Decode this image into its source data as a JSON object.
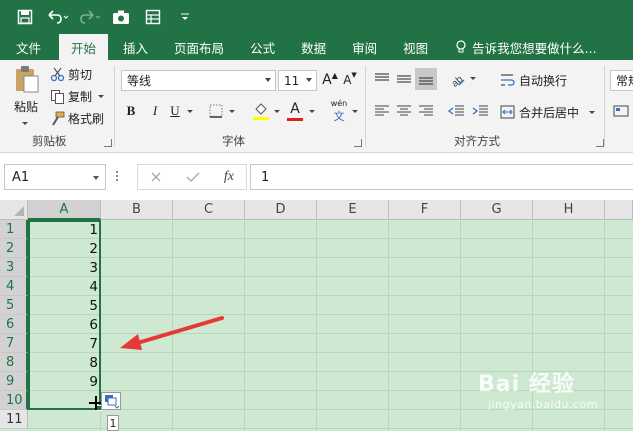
{
  "qat": {
    "icons": [
      "save-icon",
      "undo-icon",
      "redo-icon",
      "camera-icon",
      "form-icon",
      "customize-icon"
    ]
  },
  "tabs": [
    {
      "label": "文件"
    },
    {
      "label": "开始"
    },
    {
      "label": "插入"
    },
    {
      "label": "页面布局"
    },
    {
      "label": "公式"
    },
    {
      "label": "数据"
    },
    {
      "label": "审阅"
    },
    {
      "label": "视图"
    }
  ],
  "tell_me": "告诉我您想要做什么...",
  "clipboard": {
    "paste": "粘贴",
    "cut": "剪切",
    "copy": "复制",
    "format_painter": "格式刷",
    "group": "剪贴板"
  },
  "font": {
    "name": "等线",
    "size": "11",
    "bold": "B",
    "italic": "I",
    "underline": "U",
    "grow": "A",
    "shrink": "A",
    "font_color_letter": "A",
    "phonetic": "wén",
    "phonetic_sub": "文",
    "group": "字体"
  },
  "alignment": {
    "wrap": "自动换行",
    "merge": "合并后居中",
    "group": "对齐方式"
  },
  "number": {
    "format": "常规"
  },
  "formula_bar": {
    "name_box": "A1",
    "fx": "fx",
    "value": "1"
  },
  "grid": {
    "columns": [
      "A",
      "B",
      "C",
      "D",
      "E",
      "F",
      "G",
      "H"
    ],
    "rows": [
      "1",
      "2",
      "3",
      "4",
      "5",
      "6",
      "7",
      "8",
      "9",
      "10",
      "11"
    ],
    "column_a_values": [
      "1",
      "2",
      "3",
      "4",
      "5",
      "6",
      "7",
      "8",
      "9",
      "",
      ""
    ],
    "tooltip": "1"
  },
  "colors": {
    "brand": "#217346",
    "sheet_bg": "#cfe8d2",
    "arrow": "#e53935"
  },
  "watermark": {
    "main": "Bai 经验",
    "sub": "jingyan.baidu.com"
  }
}
